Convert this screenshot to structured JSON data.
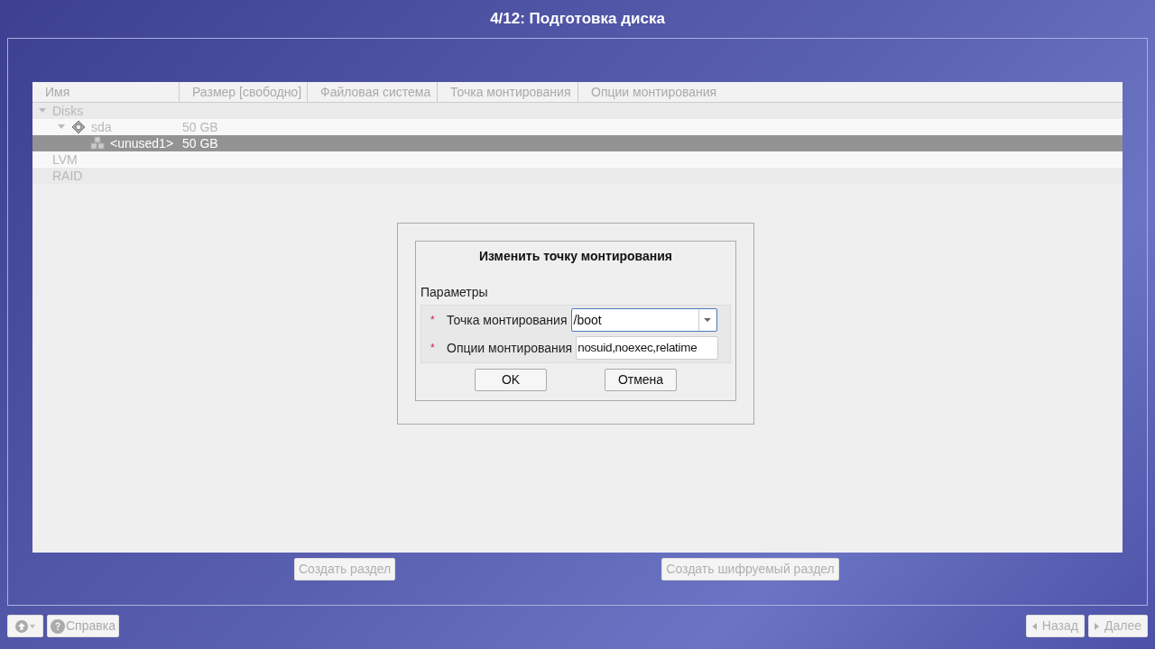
{
  "title": "4/12: Подготовка диска",
  "table": {
    "columns": [
      "Имя",
      "Размер [свободно]",
      "Файловая система",
      "Точка монтирования",
      "Опции монтирования"
    ],
    "rows": [
      {
        "kind": "group",
        "name": "Disks",
        "expanded": true,
        "selected": false,
        "children": [
          {
            "kind": "disk",
            "name": "sda",
            "size": "50 GB",
            "expanded": true,
            "selected": false,
            "children": [
              {
                "kind": "partition",
                "name": "<unused1>",
                "size": "50 GB",
                "selected": true
              }
            ]
          }
        ]
      },
      {
        "kind": "group",
        "name": "LVM",
        "selected": false
      },
      {
        "kind": "group",
        "name": "RAID",
        "selected": false
      }
    ]
  },
  "actions": [
    {
      "label": "Создать раздел",
      "disabled": true
    },
    {
      "label": "Создать шифруемый раздел",
      "disabled": true
    }
  ],
  "dialog": {
    "title": "Изменить точку монтирования",
    "section": "Параметры",
    "fields": [
      {
        "kind": "combo",
        "mark": "*",
        "label": "Точка монтирования",
        "value": "/boot",
        "focused": true
      },
      {
        "kind": "text",
        "mark": "*",
        "label": "Опции монтирования",
        "value": "nosuid,noexec,relatime",
        "focused": false
      }
    ],
    "buttons": [
      "OK",
      "Отмена"
    ]
  },
  "footer": {
    "help": "Справка",
    "back": {
      "label": "Назад",
      "disabled": true
    },
    "next": {
      "label": "Далее",
      "disabled": true
    }
  }
}
